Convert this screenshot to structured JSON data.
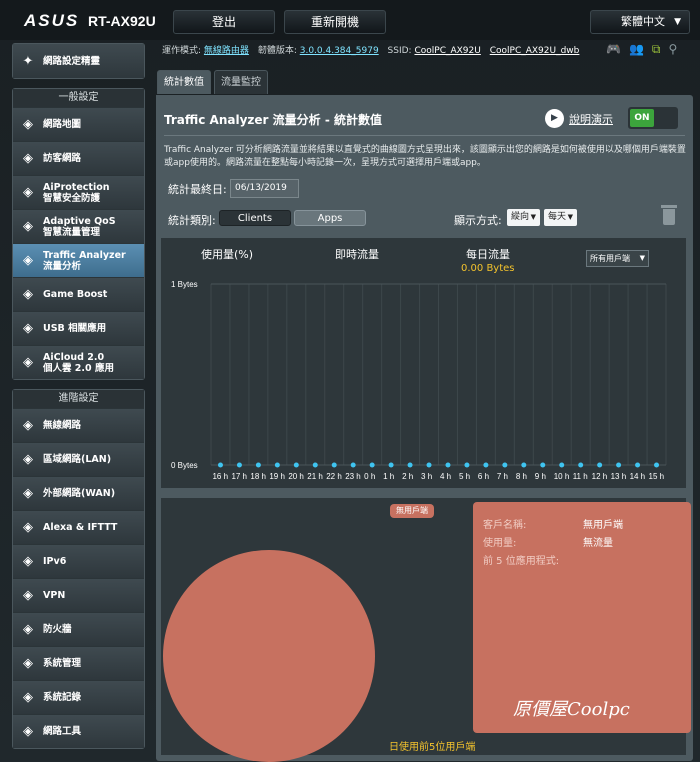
{
  "header": {
    "logo": "ASUS",
    "model": "RT-AX92U",
    "logout_label": "登出",
    "reboot_label": "重新開機",
    "language_label": "繁體中文"
  },
  "status": {
    "mode_label": "運作模式:",
    "mode_value": "無線路由器",
    "firmware_label": "韌體版本:",
    "firmware_value": "3.0.0.4.384_5979",
    "ssid_label": "SSID:",
    "ssid_value1": "CoolPC_AX92U",
    "ssid_value2": "CoolPC_AX92U_dwb"
  },
  "sidebar": {
    "quick_setup": "網路設定精靈",
    "general_header": "一般設定",
    "general_items": [
      {
        "label": "網路地圖",
        "icon": "map-icon"
      },
      {
        "label": "訪客網路",
        "icon": "guest-icon"
      },
      {
        "label": "AiProtection\n智慧安全防護",
        "icon": "shield-icon"
      },
      {
        "label": "Adaptive QoS\n智慧流量管理",
        "icon": "qos-icon"
      },
      {
        "label": "Traffic Analyzer\n流量分析",
        "icon": "traffic-icon"
      },
      {
        "label": "Game Boost",
        "icon": "gamepad-icon"
      },
      {
        "label": "USB 相關應用",
        "icon": "usb-icon"
      },
      {
        "label": "AiCloud 2.0\n個人雲 2.0 應用",
        "icon": "cloud-icon"
      }
    ],
    "advanced_header": "進階設定",
    "advanced_items": [
      {
        "label": "無線網路",
        "icon": "wireless-icon"
      },
      {
        "label": "區域網路(LAN)",
        "icon": "lan-icon"
      },
      {
        "label": "外部網路(WAN)",
        "icon": "wan-icon"
      },
      {
        "label": "Alexa & IFTTT",
        "icon": "alexa-icon"
      },
      {
        "label": "IPv6",
        "icon": "ipv6-icon"
      },
      {
        "label": "VPN",
        "icon": "vpn-icon"
      },
      {
        "label": "防火牆",
        "icon": "firewall-icon"
      },
      {
        "label": "系統管理",
        "icon": "admin-icon"
      },
      {
        "label": "系統記錄",
        "icon": "log-icon"
      },
      {
        "label": "網路工具",
        "icon": "tools-icon"
      }
    ]
  },
  "tabs": [
    "統計數值",
    "流量監控"
  ],
  "main": {
    "title": "Traffic Analyzer 流量分析 - 統計數值",
    "help_label": "說明演示",
    "toggle_label": "ON",
    "description": "Traffic Analyzer 可分析網路流量並將結果以直覺式的曲線圖方式呈現出來，該圖顯示出您的網路是如何被使用以及哪個用戶端裝置或app使用的。網路流量在整點每小時記錄一次，呈現方式可選擇用戶端或app。",
    "end_date_label": "統計最終日:",
    "end_date_value": "06/13/2019",
    "category_label": "統計類別:",
    "btn_clients": "Clients",
    "btn_apps": "Apps",
    "display_label": "顯示方式:",
    "display_select": "縱向",
    "period_select": "每天"
  },
  "chart_head": {
    "usage": "使用量(%)",
    "realtime": "即時流量",
    "daily": "每日流量",
    "daily_value": "0.00 Bytes",
    "client_select": "所有用戶端"
  },
  "chart_data": {
    "type": "bar",
    "categories": [
      "16 h",
      "17 h",
      "18 h",
      "19 h",
      "20 h",
      "21 h",
      "22 h",
      "23 h",
      "0 h",
      "1 h",
      "2 h",
      "3 h",
      "4 h",
      "5 h",
      "6 h",
      "7 h",
      "8 h",
      "9 h",
      "10 h",
      "11 h",
      "12 h",
      "13 h",
      "14 h",
      "15 h"
    ],
    "values": [
      0,
      0,
      0,
      0,
      0,
      0,
      0,
      0,
      0,
      0,
      0,
      0,
      0,
      0,
      0,
      0,
      0,
      0,
      0,
      0,
      0,
      0,
      0,
      0
    ],
    "y_ticks": [
      "1 Bytes",
      "0 Bytes"
    ],
    "ylim": [
      0,
      1
    ],
    "grid": true
  },
  "bottom": {
    "pie_label": "無用戶端",
    "client_name_label": "客戶名稱:",
    "client_name_value": "無用戶端",
    "usage_label": "使用量:",
    "usage_value": "無流量",
    "top5_label": "前 5 位應用程式:",
    "watermark": "原價屋Coolpc",
    "caption": "日使用前5位用戶端"
  },
  "colors": {
    "accent": "#3ca43c",
    "pie": "#c77160",
    "highlight": "#f3c32d",
    "chart_dot": "#3fc4f0"
  }
}
